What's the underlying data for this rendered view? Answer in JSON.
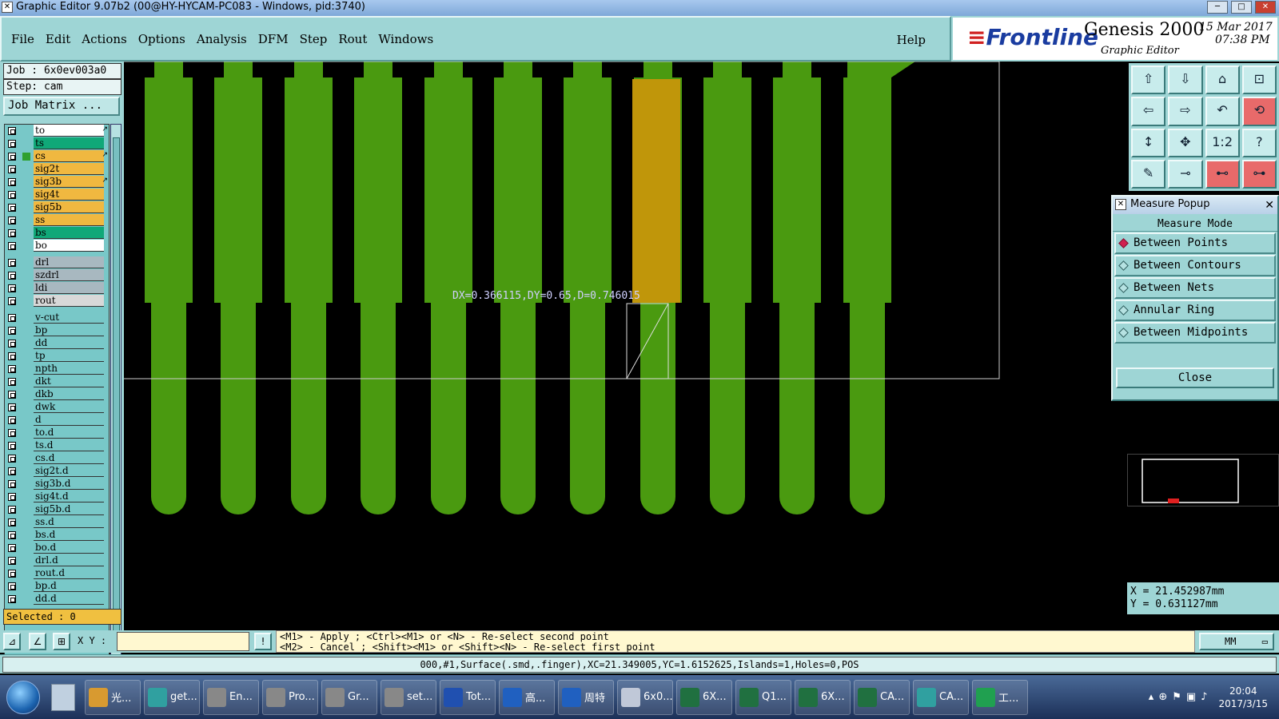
{
  "window": {
    "title": "Graphic Editor 9.07b2 (00@HY-HYCAM-PC083 - Windows, pid:3740)"
  },
  "menu": {
    "items": [
      "File",
      "Edit",
      "Actions",
      "Options",
      "Analysis",
      "DFM",
      "Step",
      "Rout",
      "Windows"
    ],
    "help": "Help"
  },
  "logo": {
    "brand": "Frontline",
    "product": "Genesis 2000",
    "subtitle": "Graphic Editor",
    "date": "15 Mar 2017",
    "time": "07:38 PM"
  },
  "job": {
    "job": "Job : 6x0ev003a0",
    "step": "Step: cam",
    "matrix_button": "Job Matrix ...",
    "selected": "Selected : 0"
  },
  "layers": [
    {
      "name": "to",
      "color": "#ffffff",
      "mark": "↗"
    },
    {
      "name": "ts",
      "color": "#10a878"
    },
    {
      "name": "cs",
      "color": "#f0b840",
      "mark": "↗",
      "active": true
    },
    {
      "name": "sig2t",
      "color": "#f0b840"
    },
    {
      "name": "sig3b",
      "color": "#f0b840",
      "mark": "↗"
    },
    {
      "name": "sig4t",
      "color": "#f0b840"
    },
    {
      "name": "sig5b",
      "color": "#f0b840"
    },
    {
      "name": "ss",
      "color": "#f0b840"
    },
    {
      "name": "bs",
      "color": "#10a878"
    },
    {
      "name": "bo",
      "color": "#ffffff",
      "sep_after": true
    },
    {
      "name": "drl",
      "color": "#a8b8c0"
    },
    {
      "name": "szdrl",
      "color": "#a8b8c0"
    },
    {
      "name": "ldi",
      "color": "#a8b8c0"
    },
    {
      "name": "rout",
      "color": "#d8d8d8",
      "sep_after": true
    },
    {
      "name": "v-cut",
      "color": "#78c8c8"
    },
    {
      "name": "bp",
      "color": "#78c8c8"
    },
    {
      "name": "dd",
      "color": "#78c8c8"
    },
    {
      "name": "tp",
      "color": "#78c8c8"
    },
    {
      "name": "npth",
      "color": "#78c8c8"
    },
    {
      "name": "dkt",
      "color": "#78c8c8"
    },
    {
      "name": "dkb",
      "color": "#78c8c8"
    },
    {
      "name": "dwk",
      "color": "#78c8c8"
    },
    {
      "name": "d",
      "color": "#78c8c8"
    },
    {
      "name": "to.d",
      "color": "#78c8c8"
    },
    {
      "name": "ts.d",
      "color": "#78c8c8"
    },
    {
      "name": "cs.d",
      "color": "#78c8c8"
    },
    {
      "name": "sig2t.d",
      "color": "#78c8c8"
    },
    {
      "name": "sig3b.d",
      "color": "#78c8c8"
    },
    {
      "name": "sig4t.d",
      "color": "#78c8c8"
    },
    {
      "name": "sig5b.d",
      "color": "#78c8c8"
    },
    {
      "name": "ss.d",
      "color": "#78c8c8"
    },
    {
      "name": "bs.d",
      "color": "#78c8c8"
    },
    {
      "name": "bo.d",
      "color": "#78c8c8"
    },
    {
      "name": "drl.d",
      "color": "#78c8c8"
    },
    {
      "name": "rout.d",
      "color": "#78c8c8"
    },
    {
      "name": "bp.d",
      "color": "#78c8c8"
    },
    {
      "name": "dd.d",
      "color": "#78c8c8"
    }
  ],
  "canvas": {
    "measure_label": "DX=0.366115,DY=0.65,D=0.746015",
    "finger_color": "#4a9a10",
    "highlight_color": "#c0960a"
  },
  "toolbar_icons": [
    "home-top-icon",
    "pan-down-icon",
    "home-icon",
    "zoom-box-icon",
    "pan-left-icon",
    "pan-right-icon",
    "zoom-back-icon",
    "redraw-icon",
    "fit-vertical-icon",
    "fit-all-icon",
    "ratio-1-2-icon",
    "help-icon",
    "tool-icon",
    "probe-icon",
    "net-red-icon",
    "net-red-2-icon"
  ],
  "ratio_label": "1:2",
  "measure_popup": {
    "title": "Measure Popup",
    "mode_header": "Measure Mode",
    "options": [
      "Between Points",
      "Between Contours",
      "Between Nets",
      "Annular Ring",
      "Between Midpoints"
    ],
    "selected": "Between Points",
    "close": "Close"
  },
  "coords": {
    "x": "X = 21.452987mm",
    "y": "Y = 0.631127mm"
  },
  "bottom": {
    "xy_label": "X Y :",
    "hint1": "<M1> - Apply  ; <Ctrl><M1> or <N> - Re-select second point",
    "hint2": "<M2> - Cancel ; <Shift><M1> or <Shift><N> - Re-select first point",
    "unit": "MM"
  },
  "status": "000,#1,Surface(.smd,.finger),XC=21.349005,YC=1.6152625,Islands=1,Holes=0,POS",
  "taskbar": {
    "items": [
      {
        "label": "光...",
        "color": "#d89a30"
      },
      {
        "label": "get...",
        "color": "#30a0a0"
      },
      {
        "label": "En...",
        "color": "#888"
      },
      {
        "label": "Pro...",
        "color": "#888"
      },
      {
        "label": "Gr...",
        "color": "#888"
      },
      {
        "label": "set...",
        "color": "#888"
      },
      {
        "label": "Tot...",
        "color": "#2050b0"
      },
      {
        "label": "高...",
        "color": "#2060c0"
      },
      {
        "label": "周特",
        "color": "#2060c0"
      },
      {
        "label": "6x0...",
        "color": "#c0c8d8"
      },
      {
        "label": "6X...",
        "color": "#207040"
      },
      {
        "label": "Q1...",
        "color": "#207040"
      },
      {
        "label": "6X...",
        "color": "#207040"
      },
      {
        "label": "CA...",
        "color": "#207040"
      },
      {
        "label": "CA...",
        "color": "#30a0a0"
      },
      {
        "label": "工...",
        "color": "#20a050"
      }
    ],
    "clock_time": "20:04",
    "clock_date": "2017/3/15"
  }
}
